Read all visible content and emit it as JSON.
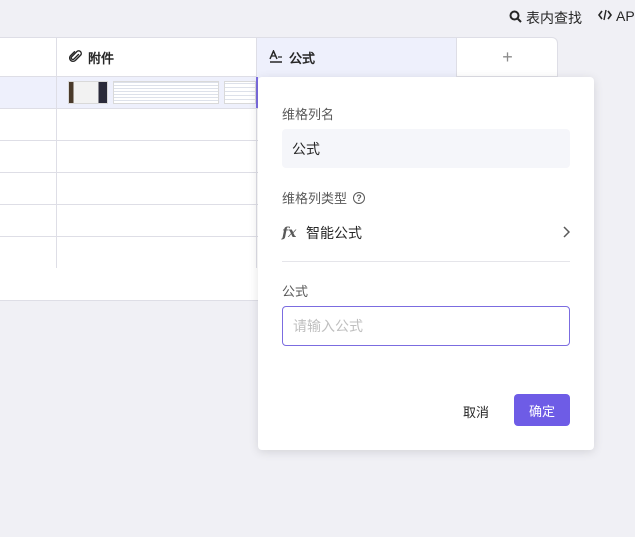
{
  "topbar": {
    "find_label": "表内查找",
    "find_icon": "search-icon",
    "api_label": "AP",
    "api_icon": "code-icon"
  },
  "grid": {
    "columns": [
      {
        "label": "附件",
        "icon": "paperclip-icon"
      },
      {
        "label": "公式",
        "icon": "text-format-icon"
      }
    ],
    "add_column_label": "+",
    "rows": [
      {
        "selected": true,
        "attachments": 3
      },
      {
        "selected": false,
        "attachments": 0
      },
      {
        "selected": false,
        "attachments": 0
      },
      {
        "selected": false,
        "attachments": 0
      },
      {
        "selected": false,
        "attachments": 0
      },
      {
        "selected": false,
        "attachments": 0
      }
    ]
  },
  "panel": {
    "name_label": "维格列名",
    "name_value": "公式",
    "type_label": "维格列类型",
    "help_icon": "?",
    "type_icon": "fx",
    "type_value": "智能公式",
    "formula_label": "公式",
    "formula_placeholder": "请输入公式",
    "formula_value": "",
    "cancel_label": "取消",
    "ok_label": "确定"
  },
  "colors": {
    "accent": "#6e5ce6",
    "header_selected_bg": "#eef0fc",
    "border": "#dedee6"
  }
}
